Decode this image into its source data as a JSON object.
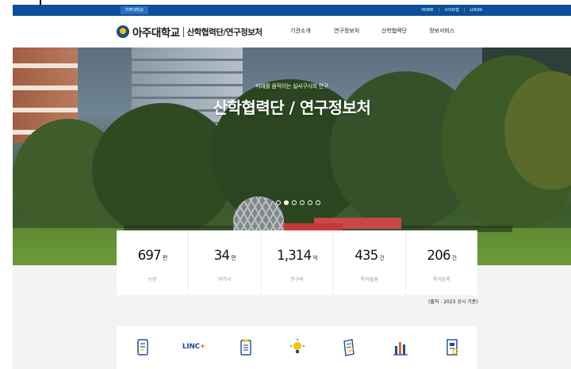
{
  "topbar": {
    "tag": "아주대학교",
    "links": [
      "HOME",
      "사이트맵",
      "LOGIN"
    ]
  },
  "header": {
    "logo_name": "아주대학교",
    "logo_sub": "산학협력단/연구정보처",
    "nav": [
      "기관소개",
      "연구정보처",
      "산학협력단",
      "정보서비스"
    ]
  },
  "hero": {
    "subtitle": "미래를 움직이는 실사구시의 연구",
    "title": "산학협력단 / 연구정보처",
    "slides": 6,
    "active_slide": 2
  },
  "stats": [
    {
      "value": "697",
      "unit": "편",
      "label": "논문"
    },
    {
      "value": "34",
      "unit": "편",
      "label": "저역서"
    },
    {
      "value": "1,314",
      "unit": "억",
      "label": "연구비"
    },
    {
      "value": "435",
      "unit": "건",
      "label": "특허출원"
    },
    {
      "value": "206",
      "unit": "건",
      "label": "특허등록"
    }
  ],
  "source_note": "(출처 : 2023 공시 기준)",
  "quick_links": {
    "linc_text": "LINC",
    "linc_suffix": "+",
    "icons": [
      "notebook-icon",
      "linc-icon",
      "clipboard-icon",
      "lightbulb-icon",
      "document-pen-icon",
      "bar-chart-icon",
      "report-icon"
    ]
  },
  "colors": {
    "topbar": "#0d4f98",
    "accent_yellow": "#f2c200",
    "section_gray": "#f3f3f3"
  }
}
